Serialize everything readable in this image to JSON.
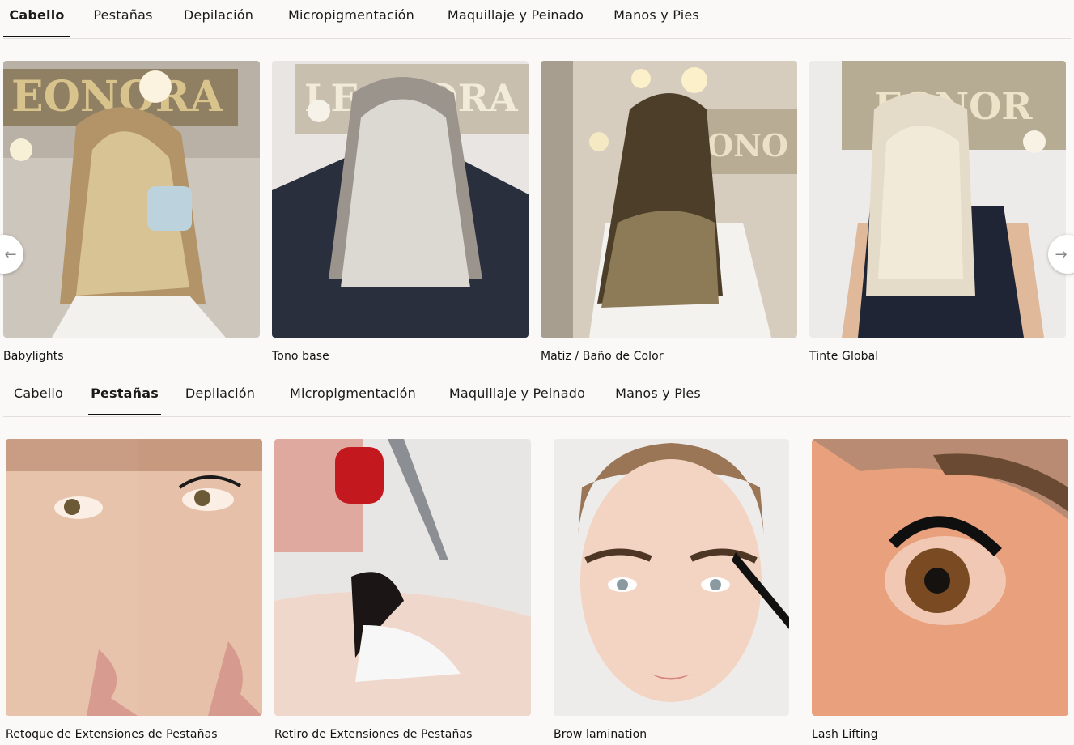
{
  "section1": {
    "tabs": [
      {
        "label": "Cabello",
        "active": true
      },
      {
        "label": "Pestañas",
        "active": false
      },
      {
        "label": "Depilación",
        "active": false
      },
      {
        "label": "Micropigmentación",
        "active": false
      },
      {
        "label": "Maquillaje y Peinado",
        "active": false
      },
      {
        "label": "Manos y Pies",
        "active": false
      }
    ],
    "cards": [
      {
        "title": "Babylights"
      },
      {
        "title": "Tono base"
      },
      {
        "title": "Matiz / Baño de Color"
      },
      {
        "title": "Tinte Global"
      }
    ],
    "prev_icon": "arrow-left-icon",
    "next_icon": "arrow-right-icon"
  },
  "section2": {
    "tabs": [
      {
        "label": "Cabello",
        "active": false
      },
      {
        "label": "Pestañas",
        "active": true
      },
      {
        "label": "Depilación",
        "active": false
      },
      {
        "label": "Micropigmentación",
        "active": false
      },
      {
        "label": "Maquillaje y Peinado",
        "active": false
      },
      {
        "label": "Manos y Pies",
        "active": false
      }
    ],
    "cards": [
      {
        "title": "Retoque de Extensiones de Pestañas"
      },
      {
        "title": "Retiro de Extensiones de Pestañas"
      },
      {
        "title": "Brow lamination"
      },
      {
        "title": "Lash Lifting"
      }
    ]
  },
  "colors": {
    "background": "#faf9f7",
    "text": "#111111",
    "divider": "#e2dfdb"
  }
}
